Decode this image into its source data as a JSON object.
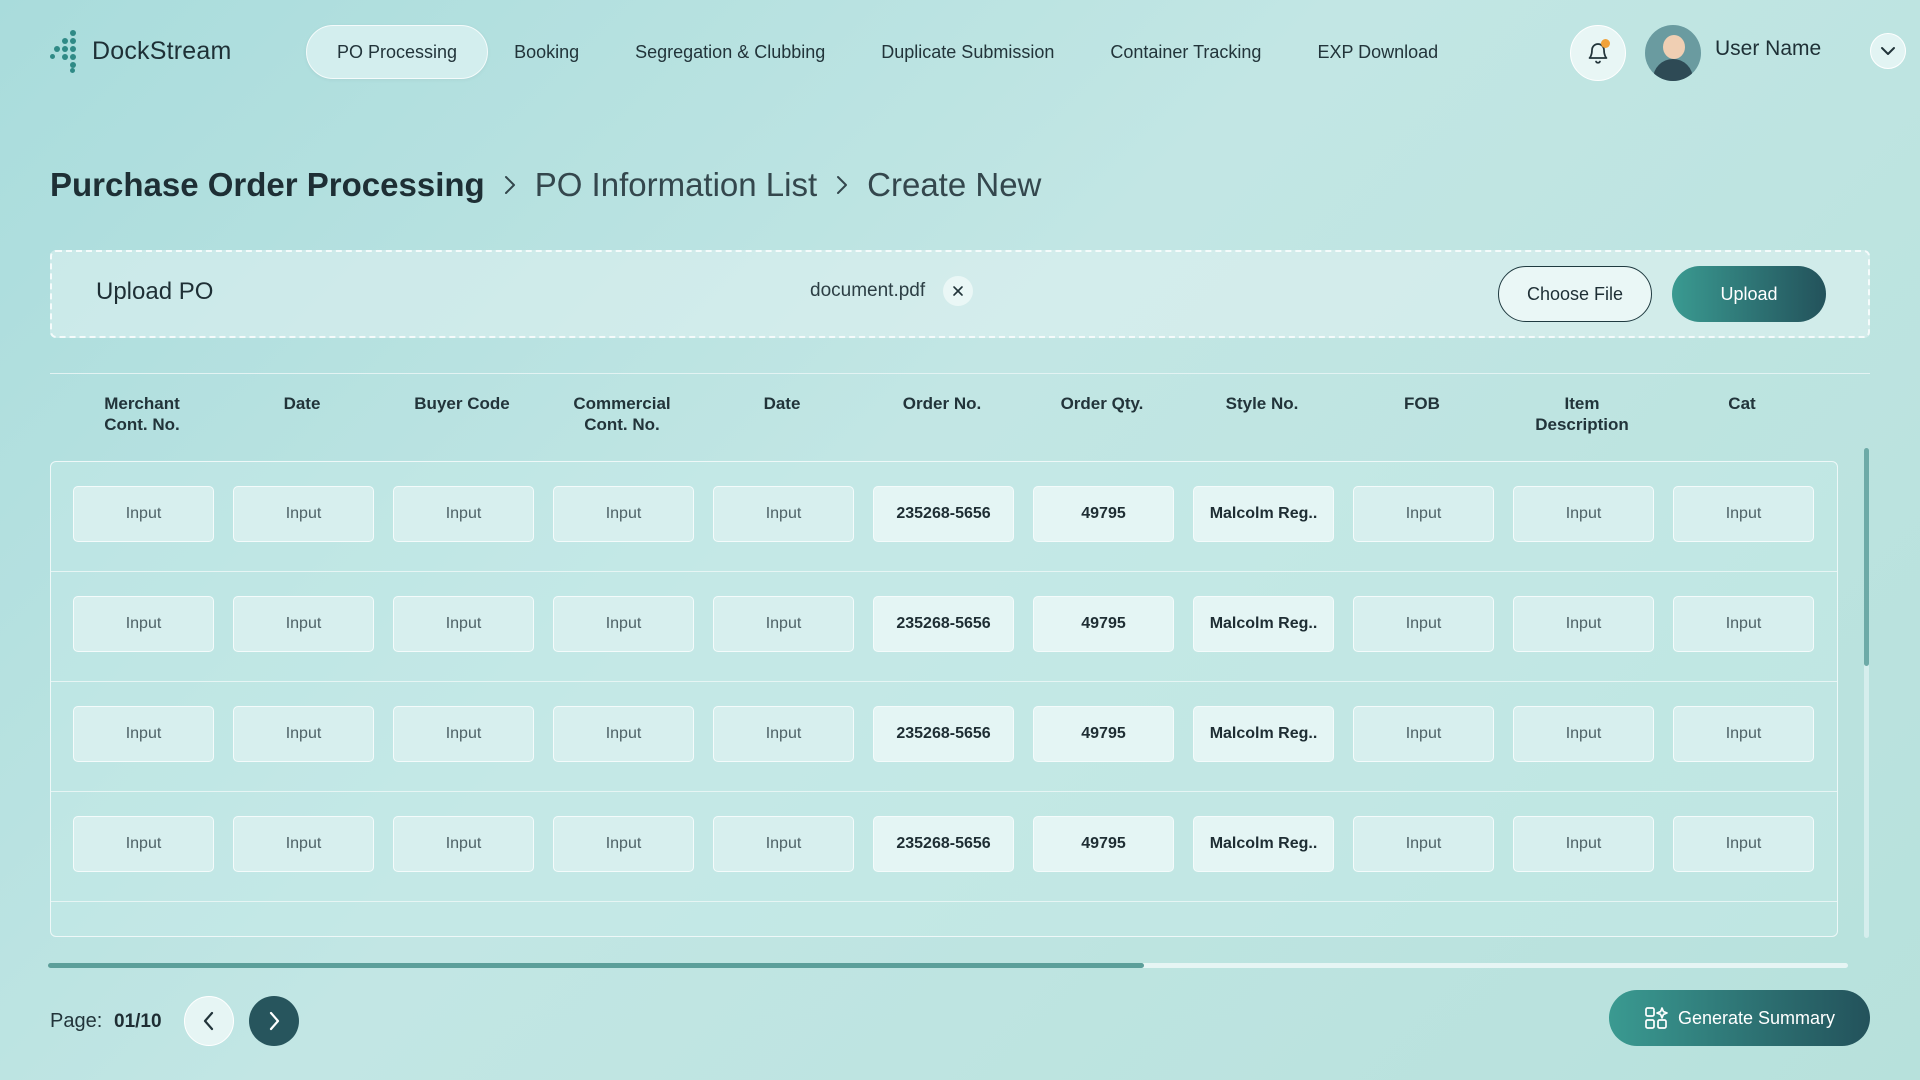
{
  "app": {
    "brand": "DockStream",
    "nav": [
      {
        "label": "PO Processing",
        "active": true
      },
      {
        "label": "Booking",
        "active": false
      },
      {
        "label": "Segregation & Clubbing",
        "active": false
      },
      {
        "label": "Duplicate Submission",
        "active": false
      },
      {
        "label": "Container Tracking",
        "active": false
      },
      {
        "label": "EXP Download",
        "active": false
      }
    ],
    "user": {
      "name": "User Name"
    },
    "icons": {
      "bell": "bell-icon",
      "notification_badge": "notification-dot",
      "chevron": "chevron-down-icon"
    },
    "colors": {
      "accent_start": "#3a9a91",
      "accent_end": "#23525b",
      "badge": "#f1a23a"
    }
  },
  "breadcrumb": {
    "items": [
      "Purchase Order Processing",
      "PO Information List",
      "Create New"
    ]
  },
  "upload": {
    "title": "Upload PO",
    "file_name": "document.pdf",
    "choose_label": "Choose File",
    "upload_label": "Upload"
  },
  "table": {
    "columns": [
      {
        "key": "merchant_cont_no",
        "label_lines": [
          "Merchant",
          "Cont. No."
        ]
      },
      {
        "key": "date_1",
        "label_lines": [
          "Date"
        ]
      },
      {
        "key": "buyer_code",
        "label_lines": [
          "Buyer Code"
        ]
      },
      {
        "key": "commercial_cont_no",
        "label_lines": [
          "Commercial",
          "Cont. No."
        ]
      },
      {
        "key": "date_2",
        "label_lines": [
          "Date"
        ]
      },
      {
        "key": "order_no",
        "label_lines": [
          "Order No."
        ]
      },
      {
        "key": "order_qty",
        "label_lines": [
          "Order Qty."
        ]
      },
      {
        "key": "style_no",
        "label_lines": [
          "Style No."
        ]
      },
      {
        "key": "fob",
        "label_lines": [
          "FOB"
        ]
      },
      {
        "key": "item_description",
        "label_lines": [
          "Item",
          "Description"
        ]
      },
      {
        "key": "cat",
        "label_lines": [
          "Cat"
        ]
      }
    ],
    "placeholder": "Input",
    "rows": [
      [
        "",
        "",
        "",
        "",
        "",
        "235268-5656",
        "49795",
        "Malcolm Reg..",
        "",
        "",
        ""
      ],
      [
        "",
        "",
        "",
        "",
        "",
        "235268-5656",
        "49795",
        "Malcolm Reg..",
        "",
        "",
        ""
      ],
      [
        "",
        "",
        "",
        "",
        "",
        "235268-5656",
        "49795",
        "Malcolm Reg..",
        "",
        "",
        ""
      ],
      [
        "",
        "",
        "",
        "",
        "",
        "235268-5656",
        "49795",
        "Malcolm Reg..",
        "",
        "",
        ""
      ]
    ]
  },
  "pagination": {
    "label": "Page:",
    "value": "01/10"
  },
  "actions": {
    "summary_label": "Generate Summary",
    "summary_icon": "apps-sparkle-icon"
  }
}
